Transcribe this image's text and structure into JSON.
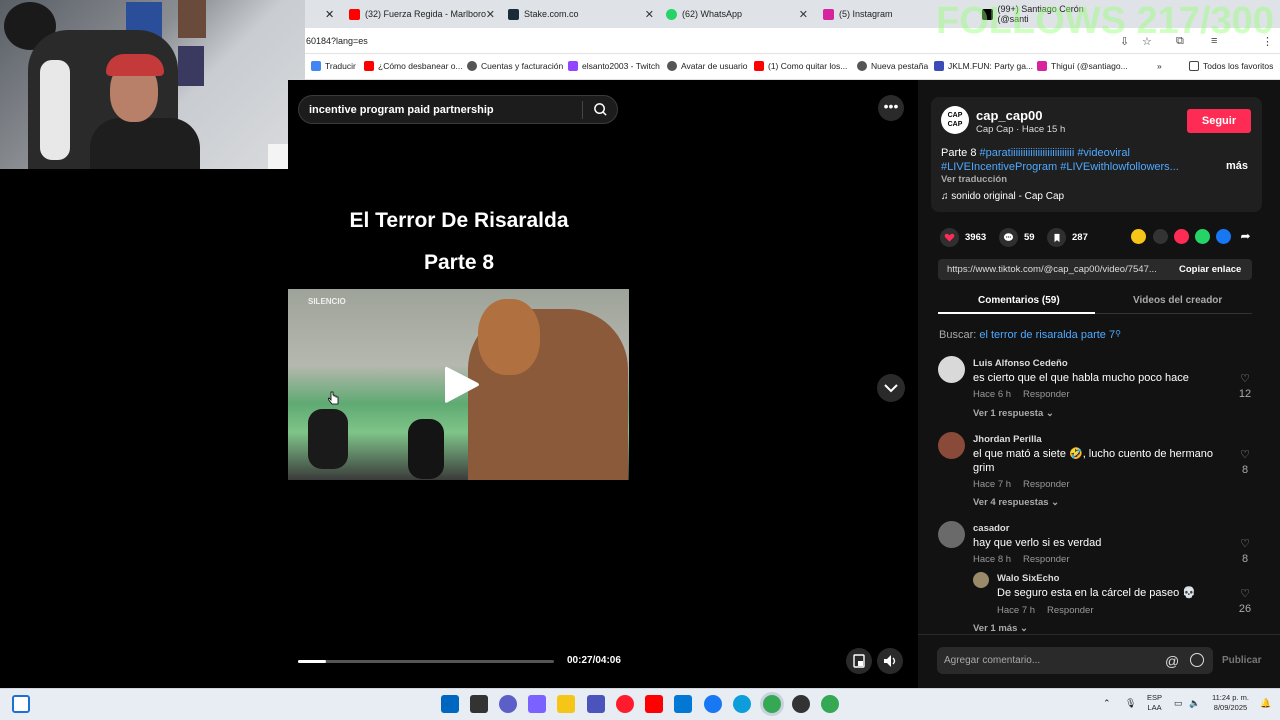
{
  "overlay": {
    "follows": "FOLLOWS 217/300"
  },
  "browser": {
    "tabs": [
      {
        "label": "(32) Fuerza Regida - Marlboro",
        "color": "#ff0000"
      },
      {
        "label": "Stake.com.co",
        "color": "#1a2c38"
      },
      {
        "label": "(62) WhatsApp",
        "color": "#25d366"
      },
      {
        "label": "(5) Instagram",
        "color": "#d6249f"
      },
      {
        "label": "(99+) Santiago Cerón (@santi",
        "color": "#000000"
      }
    ],
    "url": "60184?lang=es",
    "bookmarks": [
      {
        "label": "Traducir",
        "color": "#4285f4"
      },
      {
        "label": "¿Cómo desbanear o...",
        "color": "#ff0000"
      },
      {
        "label": "Cuentas y facturación",
        "color": "#555555"
      },
      {
        "label": "elsanto2003 - Twitch",
        "color": "#9146ff"
      },
      {
        "label": "Avatar de usuario",
        "color": "#555555"
      },
      {
        "label": "(1) Como quitar los...",
        "color": "#ff0000"
      },
      {
        "label": "Nueva pestaña",
        "color": "#555555"
      },
      {
        "label": "JKLM.FUN: Party ga...",
        "color": "#3b4cb8"
      },
      {
        "label": "Thiguí (@santiago...",
        "color": "#d6249f"
      }
    ],
    "all_bookmarks": "Todos los favoritos"
  },
  "video": {
    "search_query": "incentive program paid partnership",
    "title_line1": "El Terror De Risaralda",
    "title_line2": "Parte 8",
    "frame_logo": "SILENCIO",
    "time": "00:27/04:06",
    "progress": 0.11
  },
  "post": {
    "avatar_text": "CAP CAP",
    "username": "cap_cap00",
    "subtitle": "Cap Cap · Hace 15 h",
    "follow_label": "Seguir",
    "caption_prefix": "Parte 8 ",
    "caption_tags": "#paratiiiiiiiiiiiiiiiiiiiiiiiiii #videoviral #LIVEIncentiveProgram #LIVEwithlowfollowers...",
    "more_label": "más",
    "translate_label": "Ver traducción",
    "sound": "♫  sonido original - Cap Cap",
    "likes": "3963",
    "comments": "59",
    "saves": "287",
    "link": "https://www.tiktok.com/@cap_cap00/video/7547...",
    "copy_link": "Copiar enlace"
  },
  "tabs": {
    "comments": "Comentarios (59)",
    "creator_videos": "Videos del creador"
  },
  "search_suggestion": {
    "prefix": "Buscar: ",
    "query": "el terror de risaralda parte 7"
  },
  "comments": [
    {
      "name": "Luis Alfonso Cedeño",
      "text": "es cierto que el que habla mucho poco hace",
      "time": "Hace 6 h",
      "reply": "Responder",
      "likes": "12",
      "more": "Ver 1 respuesta ⌄",
      "avatar_color": "#d9d9d9"
    },
    {
      "name": "Jhordan Perilla",
      "text": "el que mató a siete 🤣, lucho cuento de hermano grim",
      "time": "Hace 7 h",
      "reply": "Responder",
      "likes": "8",
      "more": "Ver 4 respuestas ⌄",
      "avatar_color": "#8a4a3a"
    },
    {
      "name": "casador",
      "text": "hay que verlo si es verdad",
      "time": "Hace 8 h",
      "reply": "Responder",
      "likes": "8",
      "more": "",
      "avatar_color": "#6a6a6a"
    },
    {
      "name": "Walo SixEcho",
      "text": "De seguro esta en la cárcel de paseo 💀",
      "time": "Hace 7 h",
      "reply": "Responder",
      "likes": "26",
      "more": "Ver 1 más ⌄",
      "avatar_color": "#9a8a6a"
    }
  ],
  "comment_box": {
    "placeholder": "Agregar comentario...",
    "publish": "Publicar"
  },
  "taskbar": {
    "lang_line1": "ESP",
    "lang_line2": "LAA",
    "clock_time": "11:24 p. m.",
    "clock_date": "8/09/2025"
  }
}
